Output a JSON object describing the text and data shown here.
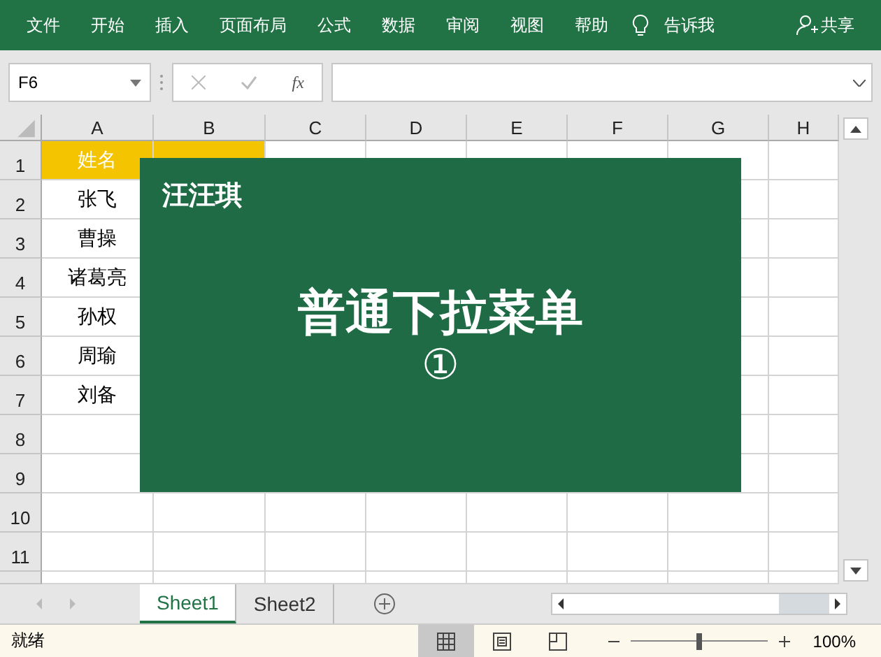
{
  "ribbon": {
    "tabs": [
      "文件",
      "开始",
      "插入",
      "页面布局",
      "公式",
      "数据",
      "审阅",
      "视图",
      "帮助"
    ],
    "tell_me": "告诉我",
    "share": "共享"
  },
  "name_box": "F6",
  "formula_bar": {
    "function_label": "fx"
  },
  "columns": [
    "A",
    "B",
    "C",
    "D",
    "E",
    "F",
    "G",
    "H"
  ],
  "rows": [
    {
      "number": "1",
      "cells": [
        "姓名",
        ""
      ],
      "header": true
    },
    {
      "number": "2",
      "cells": [
        "张飞",
        ""
      ]
    },
    {
      "number": "3",
      "cells": [
        "曹操",
        ""
      ]
    },
    {
      "number": "4",
      "cells": [
        "诸葛亮",
        ""
      ]
    },
    {
      "number": "5",
      "cells": [
        "孙权",
        ""
      ]
    },
    {
      "number": "6",
      "cells": [
        "周瑜",
        ""
      ]
    },
    {
      "number": "7",
      "cells": [
        "刘备",
        ""
      ]
    },
    {
      "number": "8",
      "cells": []
    },
    {
      "number": "9",
      "cells": []
    },
    {
      "number": "10",
      "cells": []
    },
    {
      "number": "11",
      "cells": []
    }
  ],
  "overlay": {
    "author": "汪汪琪",
    "title": "普通下拉菜单",
    "step": "①"
  },
  "sheet_tabs": [
    {
      "label": "Sheet1",
      "selected": true
    },
    {
      "label": "Sheet2",
      "selected": false
    }
  ],
  "status_bar": {
    "status": "就绪",
    "views": [
      {
        "kind": "normal",
        "selected": true
      },
      {
        "kind": "page",
        "selected": false
      },
      {
        "kind": "break",
        "selected": false
      }
    ],
    "zoom": {
      "level": 0.5,
      "reading": "100%"
    }
  }
}
